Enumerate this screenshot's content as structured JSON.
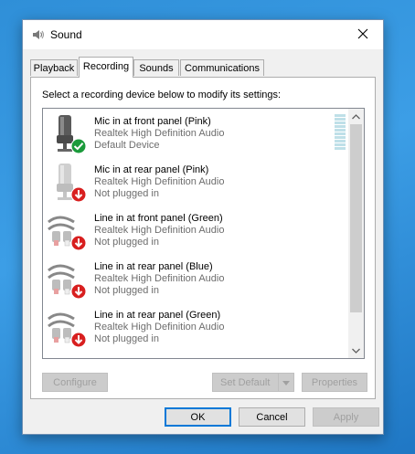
{
  "window": {
    "title": "Sound",
    "icon": "speaker-icon"
  },
  "tabs": [
    {
      "label": "Playback",
      "active": false
    },
    {
      "label": "Recording",
      "active": true
    },
    {
      "label": "Sounds",
      "active": false
    },
    {
      "label": "Communications",
      "active": false
    }
  ],
  "recording": {
    "instruction": "Select a recording device below to modify its settings:",
    "devices": [
      {
        "name": "Mic in at front panel (Pink)",
        "driver": "Realtek High Definition Audio",
        "status": "Default Device",
        "icon": "microphone-icon",
        "badge": "check-badge-icon"
      },
      {
        "name": "Mic in at rear panel (Pink)",
        "driver": "Realtek High Definition Audio",
        "status": "Not plugged in",
        "icon": "microphone-icon",
        "badge": "unplugged-badge-icon"
      },
      {
        "name": "Line in at front panel (Green)",
        "driver": "Realtek High Definition Audio",
        "status": "Not plugged in",
        "icon": "rca-cable-icon",
        "badge": "unplugged-badge-icon"
      },
      {
        "name": "Line in at rear panel (Blue)",
        "driver": "Realtek High Definition Audio",
        "status": "Not plugged in",
        "icon": "rca-cable-icon",
        "badge": "unplugged-badge-icon"
      },
      {
        "name": "Line in at rear panel (Green)",
        "driver": "Realtek High Definition Audio",
        "status": "Not plugged in",
        "icon": "rca-cable-icon",
        "badge": "unplugged-badge-icon"
      }
    ]
  },
  "panel_buttons": {
    "configure": "Configure",
    "set_default": "Set Default",
    "properties": "Properties"
  },
  "dialog_buttons": {
    "ok": "OK",
    "cancel": "Cancel",
    "apply": "Apply"
  },
  "colors": {
    "accent": "#0078d7",
    "check_badge": "#1a9a3a",
    "unplugged_badge": "#d81f1f",
    "desktop": "#2f8fd8"
  }
}
